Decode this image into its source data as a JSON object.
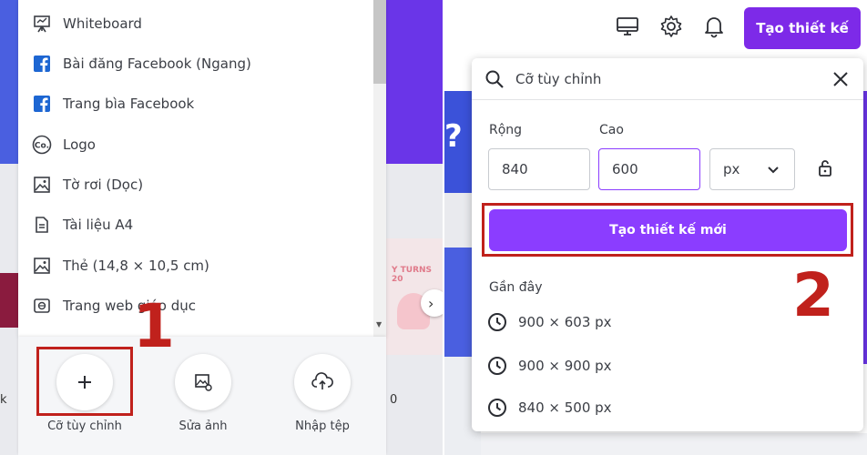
{
  "left_panel": {
    "menu_items": [
      {
        "icon": "whiteboard-icon",
        "label": "Whiteboard"
      },
      {
        "icon": "facebook-icon",
        "label": "Bài đăng Facebook (Ngang)"
      },
      {
        "icon": "facebook-icon",
        "label": "Trang bìa Facebook"
      },
      {
        "icon": "logo-icon",
        "label": "Logo"
      },
      {
        "icon": "image-icon",
        "label": "Tờ rơi (Dọc)"
      },
      {
        "icon": "document-icon",
        "label": "Tài liệu A4"
      },
      {
        "icon": "image-icon",
        "label": "Thẻ (14,8 × 10,5 cm)"
      },
      {
        "icon": "web-icon",
        "label": "Trang web giáo dục"
      }
    ],
    "quick_actions": [
      {
        "icon": "plus-icon",
        "label": "Cỡ tùy chỉnh"
      },
      {
        "icon": "edit-image-icon",
        "label": "Sửa ảnh"
      },
      {
        "icon": "upload-icon",
        "label": "Nhập tệp"
      }
    ],
    "step_number": "1",
    "partial_text_left": "k",
    "partial_text_right": "0",
    "thumb_text": "Y TURNS 20"
  },
  "right_panel": {
    "header": {
      "create_button": "Tạo thiết kế"
    },
    "popup": {
      "search_value": "Cỡ tùy chỉnh",
      "width_label": "Rộng",
      "height_label": "Cao",
      "width_value": "840",
      "height_value": "600",
      "unit": "px",
      "create_new_button": "Tạo thiết kế mới",
      "recent_heading": "Gần đây",
      "recent_items": [
        "900 × 603 px",
        "900 × 900 px",
        "840 × 500 px"
      ]
    },
    "step_number": "2",
    "question_mark": "?"
  },
  "colors": {
    "accent": "#8b3dff",
    "header_button": "#7d2ae8",
    "annotation_red": "#c0211c"
  }
}
